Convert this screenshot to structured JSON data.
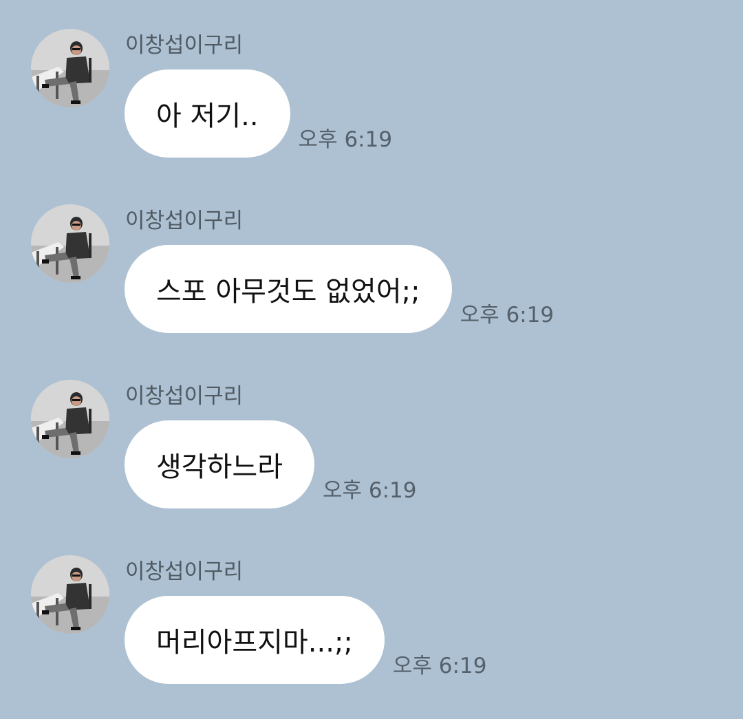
{
  "messages": [
    {
      "sender": "이창섭이구리",
      "text": "아 저기..",
      "time": "오후 6:19",
      "avatar_icon": "profile-photo"
    },
    {
      "sender": "이창섭이구리",
      "text": "스포 아무것도 없었어;;",
      "time": "오후 6:19",
      "avatar_icon": "profile-photo"
    },
    {
      "sender": "이창섭이구리",
      "text": "생각하느라",
      "time": "오후 6:19",
      "avatar_icon": "profile-photo"
    },
    {
      "sender": "이창섭이구리",
      "text": "머리아프지마...;;",
      "time": "오후 6:19",
      "avatar_icon": "profile-photo"
    }
  ],
  "colors": {
    "background": "#aec1d2",
    "bubble": "#ffffff",
    "sender_text": "#4f5a63",
    "time_text": "#55606a"
  }
}
